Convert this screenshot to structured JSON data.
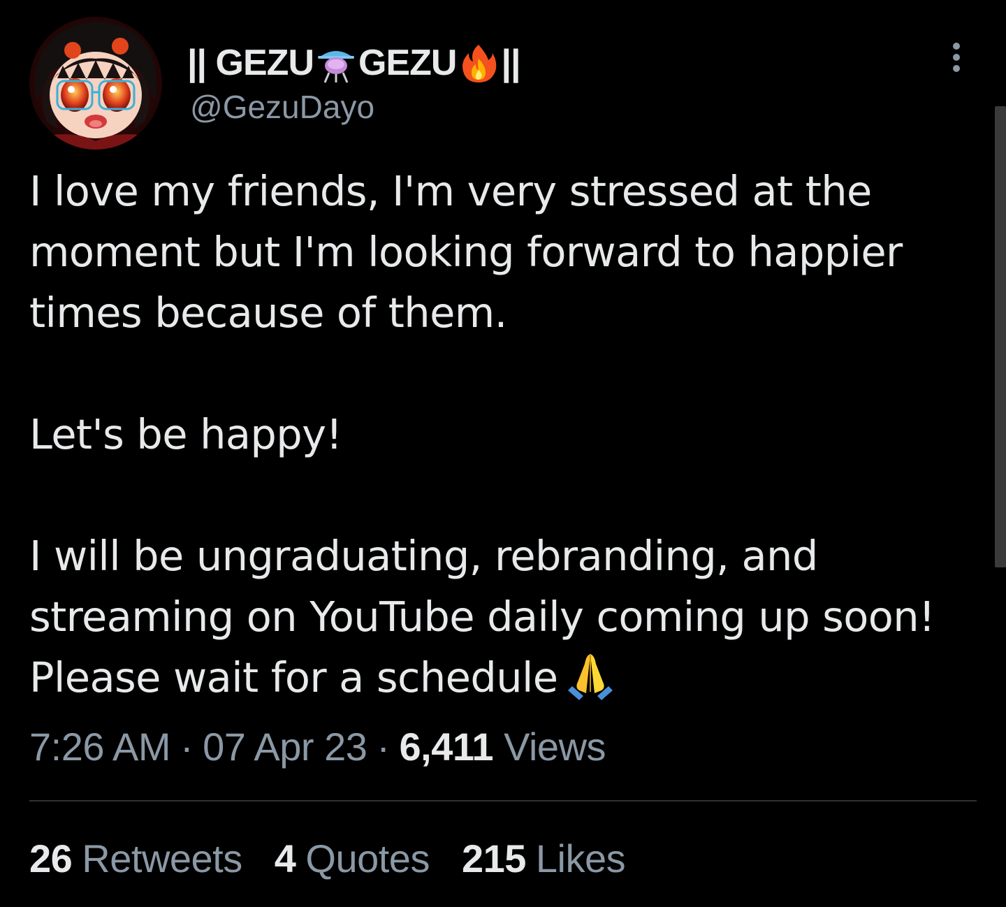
{
  "author": {
    "name_prefix": "|| GEZU",
    "name_middle": "GEZU",
    "name_suffix": "||",
    "handle": "@GezuDayo",
    "avatar_icon": "anime-girl-avatar",
    "name_emojis": [
      "alembic-flask-emoji",
      "fire-emoji"
    ]
  },
  "menu": {
    "more_icon": "more-vertical-icon"
  },
  "tweet": {
    "paragraph_1": "I love my friends, I'm very stressed at the moment but I'm looking forward to happier times because of them.",
    "paragraph_2": "Let's be happy!",
    "paragraph_3": "I will be ungraduating, rebranding, and streaming on YouTube daily coming up soon! Please wait for a schedule",
    "trailing_emoji": "folded-hands-emoji"
  },
  "meta": {
    "time": "7:26 AM",
    "date": "07 Apr 23",
    "separator": "·",
    "views_count": "6,411",
    "views_label": "Views"
  },
  "stats": {
    "retweets_count": "26",
    "retweets_label": "Retweets",
    "quotes_count": "4",
    "quotes_label": "Quotes",
    "likes_count": "215",
    "likes_label": "Likes"
  },
  "colors": {
    "background": "#000000",
    "primary_text": "#e7e9ea",
    "secondary_text": "#8b98a5",
    "divider": "#2f3336"
  }
}
